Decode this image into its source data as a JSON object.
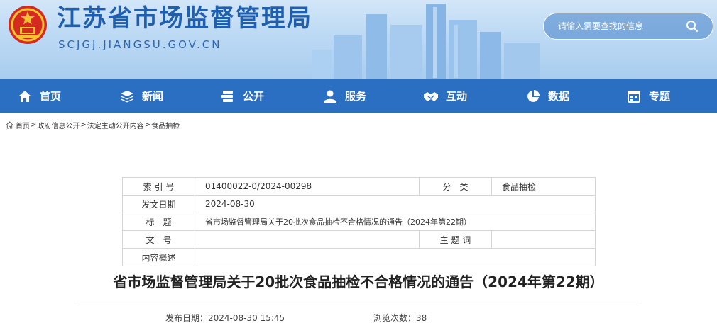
{
  "header": {
    "site_title": "江苏省市场监督管理局",
    "site_domain": "SCJGJ.JIANGSU.GOV.CN",
    "search_placeholder": "请输入需要查找的信息"
  },
  "nav": {
    "items": [
      {
        "label": "首页",
        "icon": "home-icon"
      },
      {
        "label": "新闻",
        "icon": "layers-icon"
      },
      {
        "label": "公开",
        "icon": "stack-icon"
      },
      {
        "label": "服务",
        "icon": "user-icon"
      },
      {
        "label": "互动",
        "icon": "handshake-icon"
      },
      {
        "label": "数据",
        "icon": "pie-chart-icon"
      },
      {
        "label": "专题",
        "icon": "calendar-icon"
      }
    ]
  },
  "breadcrumb": [
    "首页",
    "政府信息公开",
    "法定主动公开内容",
    "食品抽检"
  ],
  "info": {
    "index_label": "索 引 号",
    "index_value": "01400022-0/2024-00298",
    "category_label": "分　类",
    "category_value": "食品抽检",
    "date_label": "发文日期",
    "date_value": "2024-08-30",
    "title_label": "标　题",
    "title_value": "省市场监督管理局关于20批次食品抽检不合格情况的通告（2024年第22期）",
    "doc_label": "文　号",
    "doc_value": "",
    "subject_label": "主 题 词",
    "subject_value": "",
    "summary_label": "内容概述",
    "summary_value": ""
  },
  "article": {
    "title": "省市场监督管理局关于20批次食品抽检不合格情况的通告（2024年第22期）",
    "publish_label": "发布日期：",
    "publish_value": "2024-08-30 15:45",
    "views_label": "浏览次数：",
    "views_value": "38"
  },
  "colors": {
    "nav_bg": "#2b6fc2",
    "title_blue": "#1f5fb0"
  }
}
